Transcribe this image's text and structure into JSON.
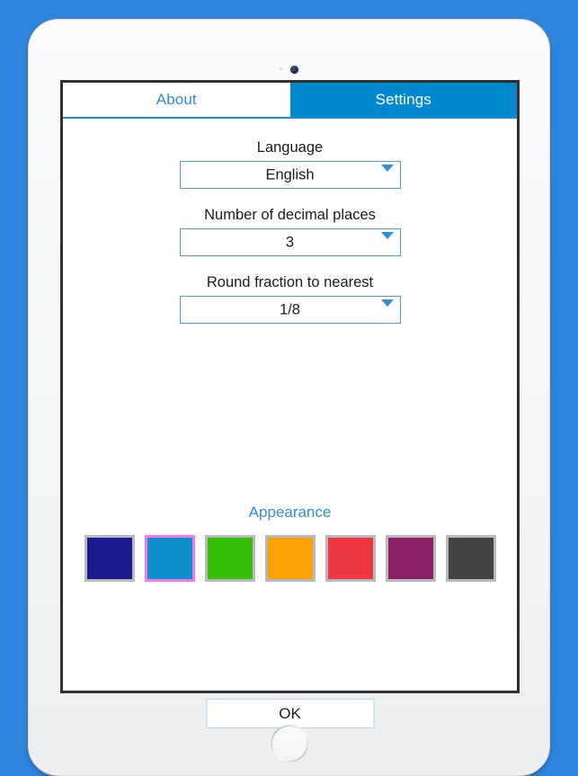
{
  "background_color": "#2e86de",
  "device": {
    "name": "tablet",
    "body_color": "#f4f5f7",
    "camera_icon": "front-camera-icon",
    "sensor_icon": "light-sensor-icon",
    "home_button_icon": "home-button-icon"
  },
  "app": {
    "tabs": [
      {
        "label": "About",
        "active": false
      },
      {
        "label": "Settings",
        "active": true
      }
    ],
    "active_tab_color": "#0288ce",
    "link_color": "#2f8fd4",
    "fields": [
      {
        "label": "Language",
        "value": "English",
        "arrow_icon": "chevron-down-icon"
      },
      {
        "label": "Number of decimal places",
        "value": "3",
        "arrow_icon": "chevron-down-icon"
      },
      {
        "label": "Round fraction to nearest",
        "value": "1/8",
        "arrow_icon": "chevron-down-icon"
      }
    ],
    "appearance": {
      "title": "Appearance",
      "selected_index": 1,
      "selection_border_color": "#f579e0",
      "swatches": [
        {
          "name": "navy",
          "color": "#1b1b8f"
        },
        {
          "name": "blue",
          "color": "#0d8fce",
          "selected": true
        },
        {
          "name": "green",
          "color": "#35bf06"
        },
        {
          "name": "orange",
          "color": "#f9a208"
        },
        {
          "name": "red",
          "color": "#ee3740"
        },
        {
          "name": "purple",
          "color": "#8a1f66"
        },
        {
          "name": "dark-gray",
          "color": "#444444"
        }
      ]
    },
    "ok_button_label": "OK"
  }
}
